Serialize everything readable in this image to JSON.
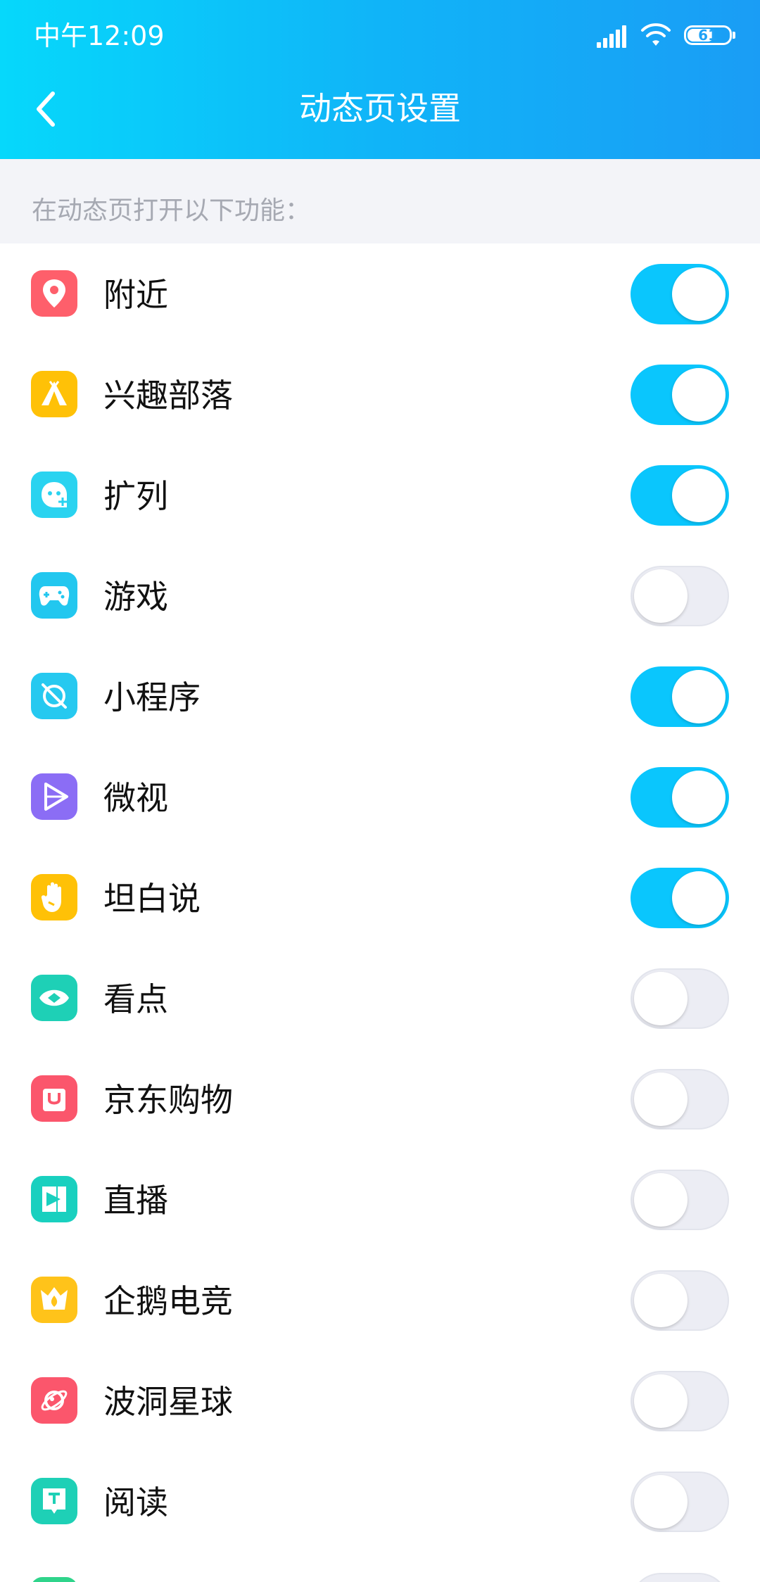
{
  "status_bar": {
    "time": "中午12:09",
    "battery": "61"
  },
  "nav": {
    "title": "动态页设置"
  },
  "section": {
    "header": "在动态页打开以下功能："
  },
  "items": [
    {
      "label": "附近",
      "on": true,
      "icon": "location-pin-icon",
      "color": "#fe5f6b"
    },
    {
      "label": "兴趣部落",
      "on": true,
      "icon": "tent-icon",
      "color": "#ffc107"
    },
    {
      "label": "扩列",
      "on": true,
      "icon": "face-plus-icon",
      "color": "#2ad3f0"
    },
    {
      "label": "游戏",
      "on": false,
      "icon": "gamepad-icon",
      "color": "#22c7ef"
    },
    {
      "label": "小程序",
      "on": true,
      "icon": "orbit-icon",
      "color": "#26c9f0"
    },
    {
      "label": "微视",
      "on": true,
      "icon": "play-icon",
      "color": "#8b6df5"
    },
    {
      "label": "坦白说",
      "on": true,
      "icon": "hand-icon",
      "color": "#ffc107"
    },
    {
      "label": "看点",
      "on": false,
      "icon": "eye-icon",
      "color": "#1ed0b6"
    },
    {
      "label": "京东购物",
      "on": false,
      "icon": "shopping-bag-icon",
      "color": "#fb566c"
    },
    {
      "label": "直播",
      "on": false,
      "icon": "live-stream-icon",
      "color": "#19d0bf"
    },
    {
      "label": "企鹅电竞",
      "on": false,
      "icon": "crown-flame-icon",
      "color": "#ffc31a"
    },
    {
      "label": "波洞星球",
      "on": false,
      "icon": "planet-icon",
      "color": "#fb566c"
    },
    {
      "label": "阅读",
      "on": false,
      "icon": "book-icon",
      "color": "#1ed0b6"
    }
  ],
  "colors": {
    "toggle_on": "#0ac6fd",
    "toggle_off": "#ecedf4",
    "header_gradient_start": "#06d8fb",
    "header_gradient_end": "#1a9df5"
  }
}
